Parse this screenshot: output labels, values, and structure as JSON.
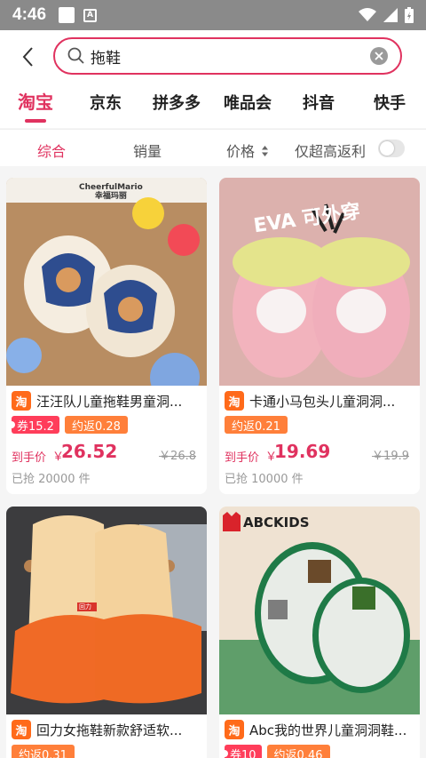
{
  "status": {
    "time": "4:46",
    "a_label": "A"
  },
  "search": {
    "value": "拖鞋"
  },
  "platforms": [
    "淘宝",
    "京东",
    "拼多多",
    "唯品会",
    "抖音",
    "快手"
  ],
  "sort": {
    "items": [
      "综合",
      "销量",
      "价格",
      "仅超高返利"
    ],
    "active": "综合"
  },
  "colors": {
    "accent": "#e0325f",
    "taobao": "#ff6a1a",
    "coupon": "#ff3d5a",
    "return": "#ff7f3a"
  },
  "products": [
    {
      "title": "汪汪队儿童拖鞋男童洞...",
      "coupon": "券15.2",
      "return": "约返0.28",
      "price_label": "到手价",
      "currency": "￥",
      "price": "26.52",
      "orig_price": "￥26.8",
      "sold": "已抢 20000 件",
      "img_brand": "CheerfulMario",
      "img_brand_cn": "幸福玛丽"
    },
    {
      "title": "卡通小马包头儿童洞洞...",
      "coupon": "",
      "return": "约返0.21",
      "price_label": "到手价",
      "currency": "￥",
      "price": "19.69",
      "orig_price": "￥19.9",
      "sold": "已抢 10000 件",
      "img_banner": "EVA 可外穿"
    },
    {
      "title": "回力女拖鞋新款舒适软...",
      "coupon": "",
      "return": "约返0.31",
      "img_logo": "回力"
    },
    {
      "title": "Abc我的世界儿童洞洞鞋...",
      "coupon": "券10",
      "return": "约返0.46",
      "img_brand": "ABCKIDS"
    }
  ],
  "tb_icon": "淘"
}
